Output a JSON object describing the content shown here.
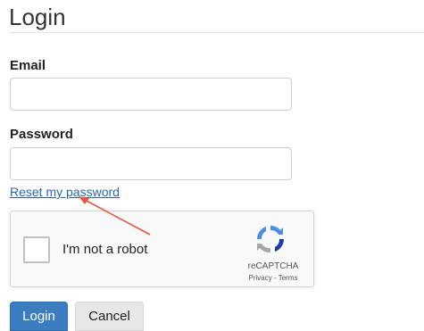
{
  "page": {
    "title": "Login"
  },
  "form": {
    "email_label": "Email",
    "email_value": "",
    "password_label": "Password",
    "password_value": "",
    "reset_link": "Reset my password"
  },
  "recaptcha": {
    "checkbox_label": "I'm not a robot",
    "brand": "reCAPTCHA",
    "links": "Privacy - Terms",
    "checked": false
  },
  "buttons": {
    "login": "Login",
    "cancel": "Cancel"
  },
  "colors": {
    "link": "#2a66b0",
    "primary_button": "#3a7ec1",
    "annotation_arrow": "#e8553e"
  },
  "icons": {
    "recaptcha_logo": "recaptcha-logo-icon",
    "annotation": "annotation-arrow-icon"
  }
}
